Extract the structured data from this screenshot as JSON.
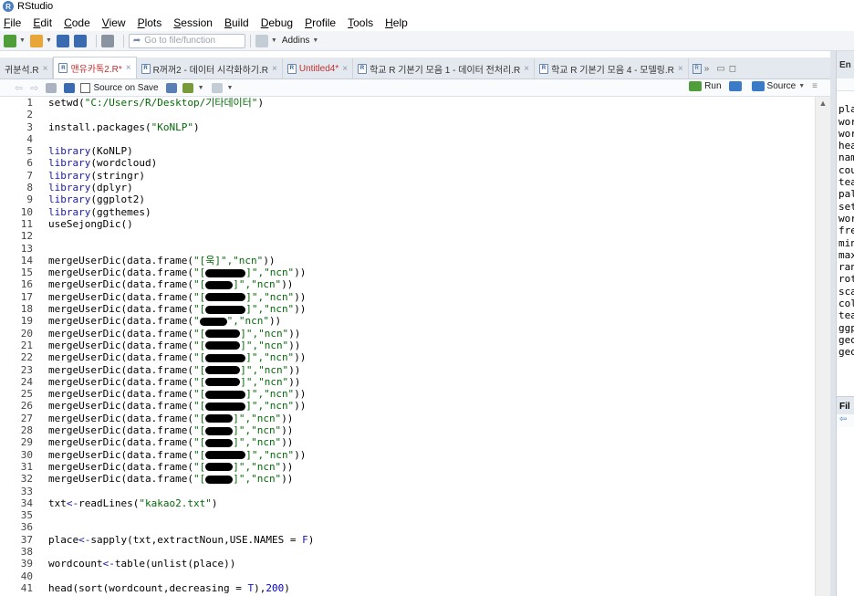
{
  "window": {
    "title": "RStudio"
  },
  "menu": [
    "File",
    "Edit",
    "Code",
    "View",
    "Plots",
    "Session",
    "Build",
    "Debug",
    "Profile",
    "Tools",
    "Help"
  ],
  "toolbar": {
    "goto_placeholder": "Go to file/function",
    "addins_label": "Addins"
  },
  "tabs": [
    {
      "label": "귀분석.R",
      "dirty": false,
      "active": false
    },
    {
      "label": "맨유카톡2.R*",
      "dirty": true,
      "active": true
    },
    {
      "label": "R꺼꺼2 - 데이터 시각화하기.R",
      "dirty": false,
      "active": false
    },
    {
      "label": "Untitled4*",
      "dirty": true,
      "active": false
    },
    {
      "label": "학교 R 기본기 모음 1 - 데이터 전처리.R",
      "dirty": false,
      "active": false
    },
    {
      "label": "학교 R 기본기 모음 4 - 모델링.R",
      "dirty": false,
      "active": false
    }
  ],
  "editor_toolbar": {
    "source_on_save": "Source on Save",
    "run_label": "Run",
    "source_label": "Source"
  },
  "colors": {
    "string": "#036a07",
    "keyword": "#1a1aa6",
    "number": "#0000cd"
  },
  "code_lines": [
    {
      "n": "1",
      "segs": [
        [
          "setwd(",
          "fn"
        ],
        [
          "\"C:/Users/R/Desktop/기타데이터\"",
          "str"
        ],
        [
          ")",
          "fn"
        ]
      ]
    },
    {
      "n": "2",
      "segs": []
    },
    {
      "n": "3",
      "segs": [
        [
          "install.packages(",
          "fn"
        ],
        [
          "\"KoNLP\"",
          "str"
        ],
        [
          ")",
          "fn"
        ]
      ]
    },
    {
      "n": "4",
      "segs": []
    },
    {
      "n": "5",
      "segs": [
        [
          "library",
          "kw"
        ],
        [
          "(KoNLP)",
          "fn"
        ]
      ]
    },
    {
      "n": "6",
      "segs": [
        [
          "library",
          "kw"
        ],
        [
          "(wordcloud)",
          "fn"
        ]
      ]
    },
    {
      "n": "7",
      "segs": [
        [
          "library",
          "kw"
        ],
        [
          "(stringr)",
          "fn"
        ]
      ]
    },
    {
      "n": "8",
      "segs": [
        [
          "library",
          "kw"
        ],
        [
          "(dplyr)",
          "fn"
        ]
      ]
    },
    {
      "n": "9",
      "segs": [
        [
          "library",
          "kw"
        ],
        [
          "(ggplot2)",
          "fn"
        ]
      ]
    },
    {
      "n": "10",
      "segs": [
        [
          "library",
          "kw"
        ],
        [
          "(ggthemes)",
          "fn"
        ]
      ]
    },
    {
      "n": "11",
      "segs": [
        [
          "useSejongDic()",
          "fn"
        ]
      ]
    },
    {
      "n": "12",
      "segs": []
    },
    {
      "n": "13",
      "segs": []
    },
    {
      "n": "14",
      "segs": [
        [
          "mergeUserDic(data.frame(",
          "fn"
        ],
        [
          "\"[욱]\",\"ncn\"",
          "str"
        ],
        [
          "))",
          "fn"
        ]
      ]
    },
    {
      "n": "15",
      "segs": [
        [
          "mergeUserDic(data.frame(",
          "fn"
        ],
        [
          "\"[",
          "str"
        ],
        [
          "R44",
          "redact"
        ],
        [
          "]\",\"ncn\"",
          "str"
        ],
        [
          "))",
          "fn"
        ]
      ]
    },
    {
      "n": "16",
      "segs": [
        [
          "mergeUserDic(data.frame(",
          "fn"
        ],
        [
          "\"[",
          "str"
        ],
        [
          "R30",
          "redact"
        ],
        [
          "]\",\"ncn\"",
          "str"
        ],
        [
          "))",
          "fn"
        ]
      ]
    },
    {
      "n": "17",
      "segs": [
        [
          "mergeUserDic(data.frame(",
          "fn"
        ],
        [
          "\"[",
          "str"
        ],
        [
          "R44",
          "redact"
        ],
        [
          "]\",\"ncn\"",
          "str"
        ],
        [
          "))",
          "fn"
        ]
      ]
    },
    {
      "n": "18",
      "segs": [
        [
          "mergeUserDic(data.frame(",
          "fn"
        ],
        [
          "\"[",
          "str"
        ],
        [
          "R44",
          "redact"
        ],
        [
          "]\",\"ncn\"",
          "str"
        ],
        [
          "))",
          "fn"
        ]
      ]
    },
    {
      "n": "19",
      "segs": [
        [
          "mergeUserDic(data.frame(",
          "fn"
        ],
        [
          "\"",
          "str"
        ],
        [
          "R30",
          "redact"
        ],
        [
          "\",\"ncn\"",
          "str"
        ],
        [
          "))",
          "fn"
        ]
      ]
    },
    {
      "n": "20",
      "segs": [
        [
          "mergeUserDic(data.frame(",
          "fn"
        ],
        [
          "\"[",
          "str"
        ],
        [
          "R38",
          "redact"
        ],
        [
          "]\",\"ncn\"",
          "str"
        ],
        [
          "))",
          "fn"
        ]
      ]
    },
    {
      "n": "21",
      "segs": [
        [
          "mergeUserDic(data.frame(",
          "fn"
        ],
        [
          "\"[",
          "str"
        ],
        [
          "R38",
          "redact"
        ],
        [
          "]\",\"ncn\"",
          "str"
        ],
        [
          "))",
          "fn"
        ]
      ]
    },
    {
      "n": "22",
      "segs": [
        [
          "mergeUserDic(data.frame(",
          "fn"
        ],
        [
          "\"[",
          "str"
        ],
        [
          "R44",
          "redact"
        ],
        [
          "]\",\"ncn\"",
          "str"
        ],
        [
          "))",
          "fn"
        ]
      ]
    },
    {
      "n": "23",
      "segs": [
        [
          "mergeUserDic(data.frame(",
          "fn"
        ],
        [
          "\"[",
          "str"
        ],
        [
          "R38",
          "redact"
        ],
        [
          "]\",\"ncn\"",
          "str"
        ],
        [
          "))",
          "fn"
        ]
      ]
    },
    {
      "n": "24",
      "segs": [
        [
          "mergeUserDic(data.frame(",
          "fn"
        ],
        [
          "\"[",
          "str"
        ],
        [
          "R38",
          "redact"
        ],
        [
          "]\",\"ncn\"",
          "str"
        ],
        [
          "))",
          "fn"
        ]
      ]
    },
    {
      "n": "25",
      "segs": [
        [
          "mergeUserDic(data.frame(",
          "fn"
        ],
        [
          "\"[",
          "str"
        ],
        [
          "R44",
          "redact"
        ],
        [
          "]\",\"ncn\"",
          "str"
        ],
        [
          "))",
          "fn"
        ]
      ]
    },
    {
      "n": "26",
      "segs": [
        [
          "mergeUserDic(data.frame(",
          "fn"
        ],
        [
          "\"[",
          "str"
        ],
        [
          "R44",
          "redact"
        ],
        [
          "]\",\"ncn\"",
          "str"
        ],
        [
          "))",
          "fn"
        ]
      ]
    },
    {
      "n": "27",
      "segs": [
        [
          "mergeUserDic(data.frame(",
          "fn"
        ],
        [
          "\"[",
          "str"
        ],
        [
          "R30",
          "redact"
        ],
        [
          "]\",\"ncn\"",
          "str"
        ],
        [
          "))",
          "fn"
        ]
      ]
    },
    {
      "n": "28",
      "segs": [
        [
          "mergeUserDic(data.frame(",
          "fn"
        ],
        [
          "\"[",
          "str"
        ],
        [
          "R30",
          "redact"
        ],
        [
          "]\",\"ncn\"",
          "str"
        ],
        [
          "))",
          "fn"
        ]
      ]
    },
    {
      "n": "29",
      "segs": [
        [
          "mergeUserDic(data.frame(",
          "fn"
        ],
        [
          "\"[",
          "str"
        ],
        [
          "R30",
          "redact"
        ],
        [
          "]\",\"ncn\"",
          "str"
        ],
        [
          "))",
          "fn"
        ]
      ]
    },
    {
      "n": "30",
      "segs": [
        [
          "mergeUserDic(data.frame(",
          "fn"
        ],
        [
          "\"[",
          "str"
        ],
        [
          "R44",
          "redact"
        ],
        [
          "]\",\"ncn\"",
          "str"
        ],
        [
          "))",
          "fn"
        ]
      ]
    },
    {
      "n": "31",
      "segs": [
        [
          "mergeUserDic(data.frame(",
          "fn"
        ],
        [
          "\"[",
          "str"
        ],
        [
          "R30",
          "redact"
        ],
        [
          "]\",\"ncn\"",
          "str"
        ],
        [
          "))",
          "fn"
        ]
      ]
    },
    {
      "n": "32",
      "segs": [
        [
          "mergeUserDic(data.frame(",
          "fn"
        ],
        [
          "\"[",
          "str"
        ],
        [
          "R30",
          "redact"
        ],
        [
          "]\",\"ncn\"",
          "str"
        ],
        [
          "))",
          "fn"
        ]
      ]
    },
    {
      "n": "33",
      "segs": []
    },
    {
      "n": "34",
      "segs": [
        [
          "txt",
          "fn"
        ],
        [
          "<-",
          "kw"
        ],
        [
          "readLines(",
          "fn"
        ],
        [
          "\"kakao2.txt\"",
          "str"
        ],
        [
          ")",
          "fn"
        ]
      ]
    },
    {
      "n": "35",
      "segs": []
    },
    {
      "n": "36",
      "segs": []
    },
    {
      "n": "37",
      "segs": [
        [
          "place",
          "fn"
        ],
        [
          "<-",
          "kw"
        ],
        [
          "sapply(txt,extractNoun,USE.NAMES = ",
          "fn"
        ],
        [
          "F",
          "kw"
        ],
        [
          ")",
          "fn"
        ]
      ]
    },
    {
      "n": "38",
      "segs": []
    },
    {
      "n": "39",
      "segs": [
        [
          "wordcount",
          "fn"
        ],
        [
          "<-",
          "kw"
        ],
        [
          "table(unlist(place))",
          "fn"
        ]
      ]
    },
    {
      "n": "40",
      "segs": []
    },
    {
      "n": "41",
      "segs": [
        [
          "head(sort(wordcount,decreasing = ",
          "fn"
        ],
        [
          "T",
          "kw"
        ],
        [
          "),",
          "fn"
        ],
        [
          "200",
          "num"
        ],
        [
          ")",
          "fn"
        ]
      ]
    }
  ],
  "right_pane": {
    "tab_label": "En",
    "lines": [
      "",
      "pla",
      "wor",
      "wor",
      "hea",
      "nam",
      "cou",
      "tea",
      "pal",
      "set",
      "wor",
      "fre",
      "min",
      "max",
      "ran",
      "rot",
      "sca",
      "col",
      "tea",
      "ggp",
      "geo",
      "geo"
    ],
    "files_tab_label": "Fil"
  }
}
